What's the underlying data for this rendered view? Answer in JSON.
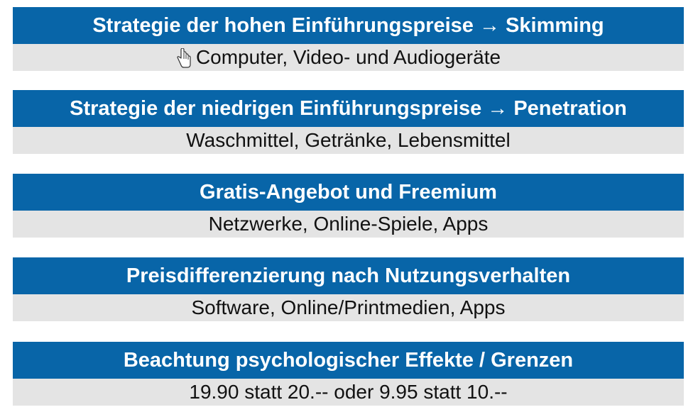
{
  "items": [
    {
      "title": "Strategie der hohen Einführungspreise → Skimming",
      "examples": "Computer, Video- und Audiogeräte"
    },
    {
      "title": "Strategie der niedrigen Einführungspreise → Penetration",
      "examples": "Waschmittel, Getränke, Lebensmittel"
    },
    {
      "title": "Gratis-Angebot und Freemium",
      "examples": "Netzwerke, Online-Spiele, Apps"
    },
    {
      "title": "Preisdifferenzierung nach Nutzungsverhalten",
      "examples": "Software, Online/Printmedien, Apps"
    },
    {
      "title": "Beachtung psychologischer Effekte / Grenzen",
      "examples": "19.90 statt 20.-- oder 9.95 statt 10.--"
    }
  ],
  "cursor": {
    "icon": "hand-cursor-icon"
  }
}
